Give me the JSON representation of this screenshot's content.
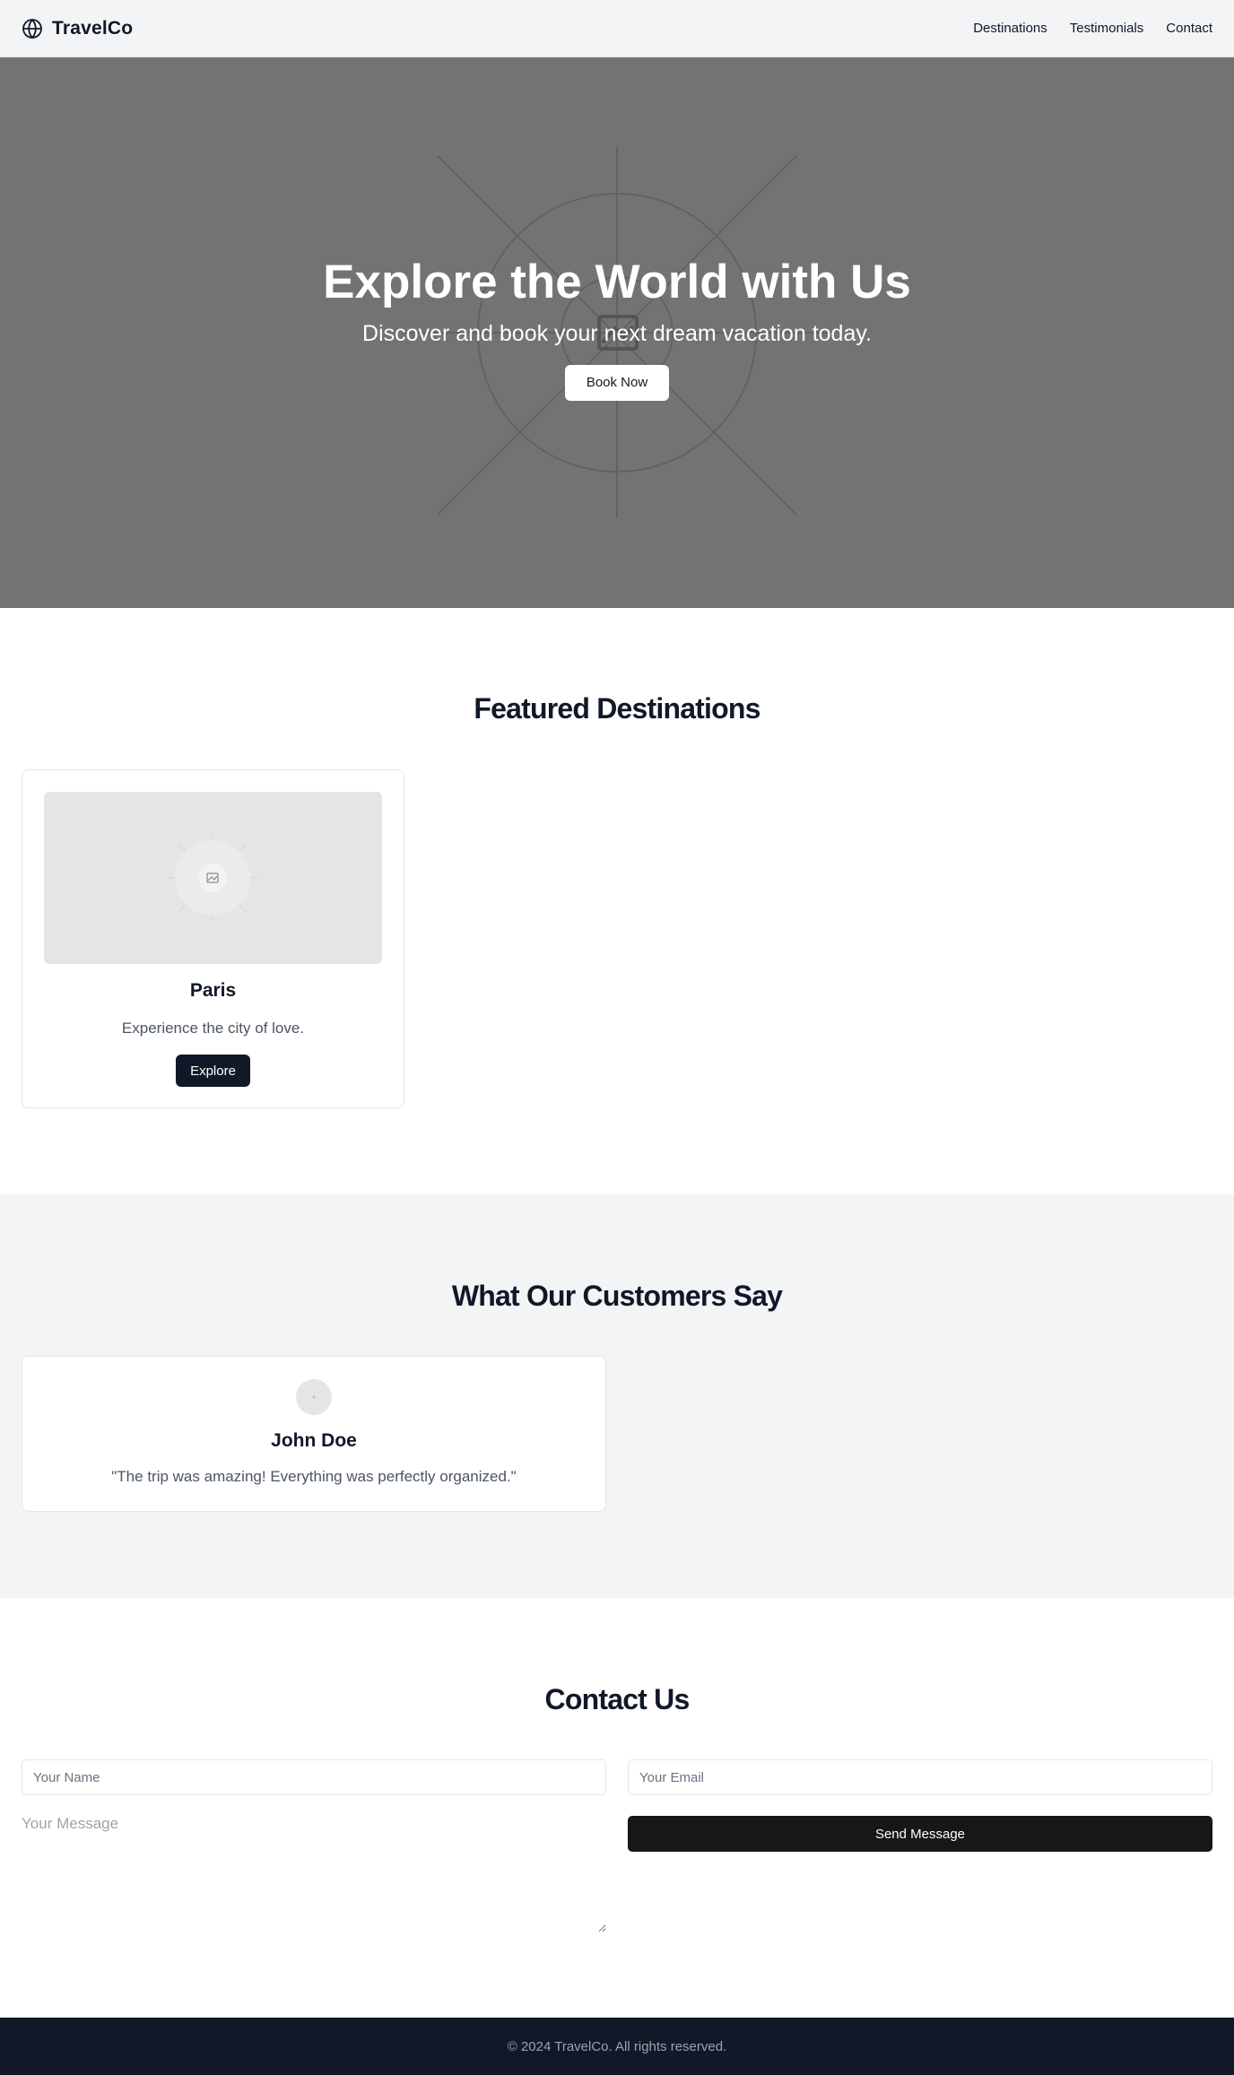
{
  "nav": {
    "brand": "TravelCo",
    "brand_icon": "globe-icon",
    "links": [
      "Destinations",
      "Testimonials",
      "Contact"
    ]
  },
  "hero": {
    "title": "Explore the World with Us",
    "subtitle": "Discover and book your next dream vacation today.",
    "button": "Book Now",
    "image_icon": "image-placeholder-icon"
  },
  "destinations": {
    "title": "Featured Destinations",
    "cards": [
      {
        "name": "Paris",
        "description": "Experience the city of love.",
        "button": "Explore",
        "image_icon": "image-placeholder-icon"
      }
    ]
  },
  "testimonials": {
    "title": "What Our Customers Say",
    "items": [
      {
        "name": "John Doe",
        "quote": "\"The trip was amazing! Everything was perfectly organized.\"",
        "avatar_icon": "avatar-placeholder-icon"
      }
    ]
  },
  "contact": {
    "title": "Contact Us",
    "name_placeholder": "Your Name",
    "email_placeholder": "Your Email",
    "message_placeholder": "Your Message",
    "button": "Send Message"
  },
  "footer": {
    "text": "© 2024 TravelCo. All rights reserved."
  },
  "colors": {
    "nav_bg": "#f3f4f6",
    "hero_bg": "#737373",
    "primary_dark": "#111827",
    "send_button": "#171717",
    "section_alt_bg": "#f3f4f6",
    "footer_bg": "#111827"
  }
}
